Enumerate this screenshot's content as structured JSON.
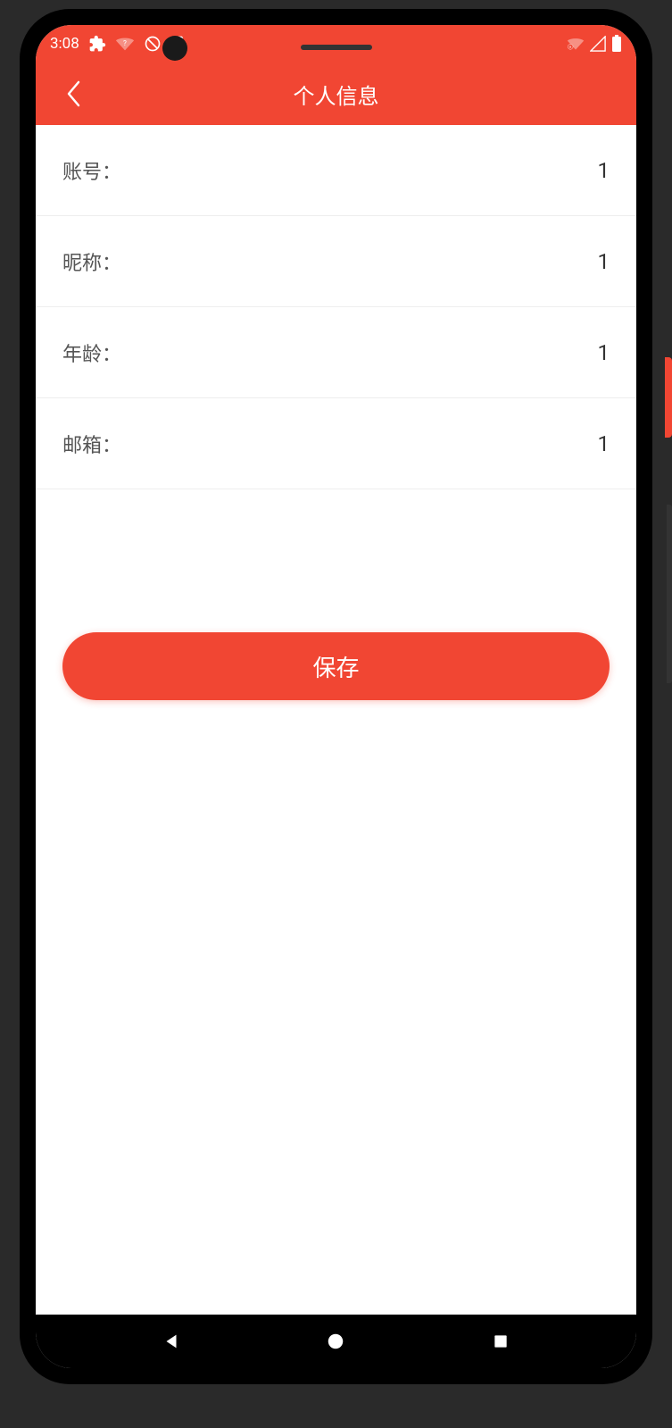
{
  "statusBar": {
    "time": "3:08"
  },
  "header": {
    "title": "个人信息"
  },
  "form": {
    "rows": [
      {
        "label": "账号：",
        "value": "1"
      },
      {
        "label": "昵称：",
        "value": "1"
      },
      {
        "label": "年龄：",
        "value": "1"
      },
      {
        "label": "邮箱：",
        "value": "1"
      }
    ]
  },
  "saveButton": {
    "label": "保存"
  }
}
